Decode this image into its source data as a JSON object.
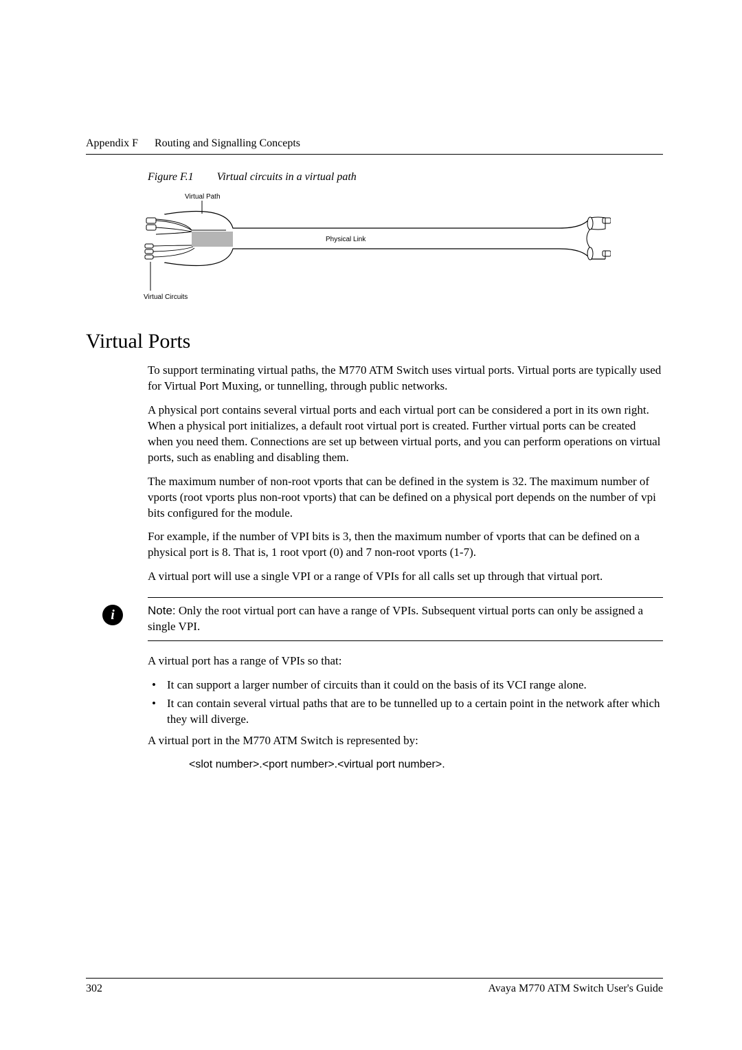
{
  "header": {
    "appendix": "Appendix F",
    "chapter": "Routing and Signalling Concepts"
  },
  "figure": {
    "number": "Figure F.1",
    "caption": "Virtual circuits in a virtual path",
    "labels": {
      "virtual_path": "Virtual Path",
      "physical_link": "Physical Link",
      "virtual_circuits": "Virtual Circuits"
    }
  },
  "section": {
    "title": "Virtual Ports",
    "p1": "To support terminating virtual paths, the M770 ATM Switch uses virtual ports. Virtual ports are typically used for Virtual Port Muxing, or tunnelling, through public networks.",
    "p2": "A physical port contains several virtual ports and each virtual port can be considered a port in its own right. When a physical port initializes, a default root virtual port is created. Further virtual ports can be created when you need them. Connections are set up between virtual ports, and you can perform operations on virtual ports, such as enabling and disabling them.",
    "p3": "The maximum number of non-root vports that can be defined in the system is 32. The maximum number of vports (root vports plus non-root vports) that can be defined on a physical port depends on the number of vpi bits configured for the module.",
    "p4": "For example, if the number of VPI bits is 3, then the maximum number of vports that can be defined on a physical port is 8. That is, 1 root vport (0) and 7 non-root vports (1-7).",
    "p5": "A virtual port will use a single VPI or a range of VPIs for all calls set up through that virtual port."
  },
  "note": {
    "label": "Note:",
    "text": " Only the root virtual port can have a range of VPIs. Subsequent virtual ports can only be assigned a single VPI."
  },
  "after_note": {
    "p1": "A virtual port has a range of VPIs so that:",
    "bullets": [
      "It can support a larger number of circuits than it could on the basis of its VCI range alone.",
      "It can contain several virtual paths that are to be tunnelled up to a certain point in the network after which they will diverge."
    ],
    "p2": "A virtual port in the M770 ATM Switch is represented by:",
    "code": "<slot number>.<port number>.<virtual port number>."
  },
  "footer": {
    "page": "302",
    "doc": "Avaya M770 ATM Switch User's Guide"
  }
}
